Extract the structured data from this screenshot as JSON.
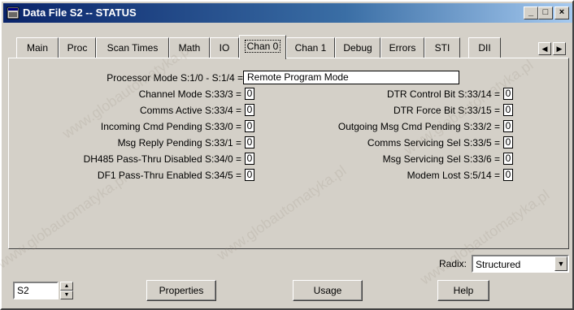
{
  "window": {
    "title": "Data File S2  --  STATUS",
    "controls": {
      "minimize": "_",
      "maximize": "□",
      "close": "×"
    }
  },
  "tabs": [
    {
      "label": "Main"
    },
    {
      "label": "Proc"
    },
    {
      "label": "Scan Times"
    },
    {
      "label": "Math"
    },
    {
      "label": "IO"
    },
    {
      "label": "Chan 0"
    },
    {
      "label": "Chan 1"
    },
    {
      "label": "Debug"
    },
    {
      "label": "Errors"
    },
    {
      "label": "STI"
    },
    {
      "label": "DII"
    }
  ],
  "active_tab": "Chan 0",
  "fields": {
    "processor_mode": {
      "label": "Processor Mode S:1/0 - S:1/4 =",
      "value": "Remote Program Mode"
    },
    "left": [
      {
        "label": "Channel Mode S:33/3 =",
        "value": "0"
      },
      {
        "label": "Comms Active S:33/4 =",
        "value": "0"
      },
      {
        "label": "Incoming Cmd Pending S:33/0 =",
        "value": "0"
      },
      {
        "label": "Msg Reply Pending S:33/1 =",
        "value": "0"
      },
      {
        "label": "DH485 Pass-Thru Disabled S:34/0 =",
        "value": "0"
      },
      {
        "label": "DF1 Pass-Thru Enabled S:34/5 =",
        "value": "0"
      }
    ],
    "right": [
      {
        "label": "DTR Control Bit S:33/14 =",
        "value": "0"
      },
      {
        "label": "DTR Force  Bit S:33/15 =",
        "value": "0"
      },
      {
        "label": "Outgoing Msg Cmd Pending S:33/2 =",
        "value": "0"
      },
      {
        "label": "Comms Servicing Sel S:33/5 =",
        "value": "0"
      },
      {
        "label": "Msg Servicing Sel S:33/6 =",
        "value": "0"
      },
      {
        "label": "Modem Lost S:5/14 =",
        "value": "0"
      }
    ]
  },
  "radix": {
    "label": "Radix:",
    "value": "Structured"
  },
  "file_field": {
    "value": "S2"
  },
  "buttons": {
    "properties": "Properties",
    "usage": "Usage",
    "help": "Help"
  },
  "watermark": "www.globautomatyka.pl",
  "colors": {
    "titlebar_start": "#0a246a",
    "titlebar_end": "#a6caf0",
    "face": "#d4d0c8"
  }
}
